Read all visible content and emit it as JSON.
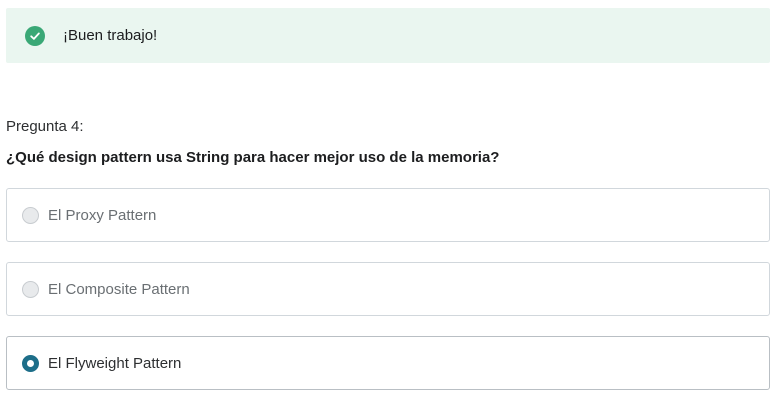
{
  "feedback": {
    "message": "¡Buen trabajo!",
    "icon": "check-circle-icon",
    "color": "#3aa876"
  },
  "question": {
    "number_label": "Pregunta 4:",
    "text": "¿Qué design pattern usa String para hacer mejor uso de la memoria?"
  },
  "options": [
    {
      "label": "El Proxy Pattern",
      "selected": false
    },
    {
      "label": "El Composite Pattern",
      "selected": false
    },
    {
      "label": "El Flyweight Pattern",
      "selected": true
    }
  ],
  "accent_color": "#1d6e89"
}
